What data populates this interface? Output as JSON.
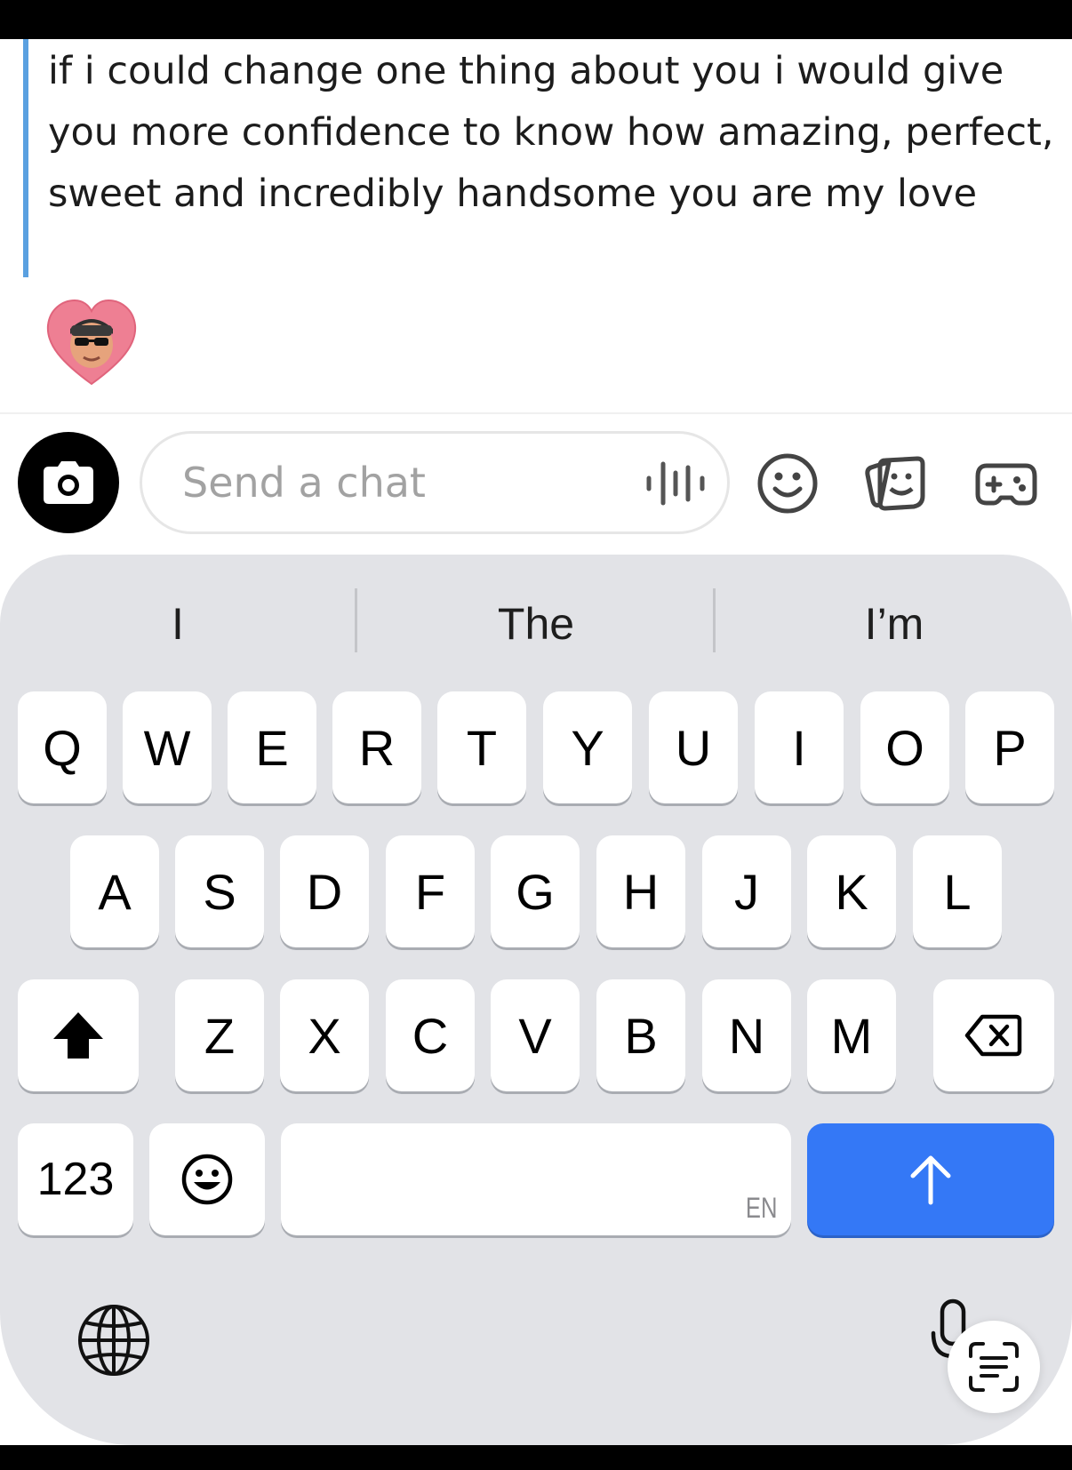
{
  "message": {
    "text": "if i could change one thing about you i would give you more confidence to know how amazing, perfect, sweet and incredibly handsome you are my love",
    "reaction_icon": "bitmoji-heart-reaction-icon",
    "quote_bar_color": "#5aa0e0"
  },
  "composer": {
    "placeholder": "Send a chat",
    "icons": [
      "camera-icon",
      "voice-note-icon",
      "emoji-smile-icon",
      "stickers-icon",
      "games-controller-icon"
    ]
  },
  "keyboard": {
    "suggestions": [
      "I",
      "The",
      "I’m"
    ],
    "rows": [
      [
        "Q",
        "W",
        "E",
        "R",
        "T",
        "Y",
        "U",
        "I",
        "O",
        "P"
      ],
      [
        "A",
        "S",
        "D",
        "F",
        "G",
        "H",
        "J",
        "K",
        "L"
      ],
      [
        "Z",
        "X",
        "C",
        "V",
        "B",
        "N",
        "M"
      ]
    ],
    "numbers_label": "123",
    "space_language": "EN",
    "send_color": "#3478f6",
    "icons": [
      "shift-icon",
      "backspace-icon",
      "emoji-keyboard-icon",
      "send-arrow-icon",
      "globe-icon",
      "microphone-icon",
      "text-scan-icon"
    ]
  }
}
